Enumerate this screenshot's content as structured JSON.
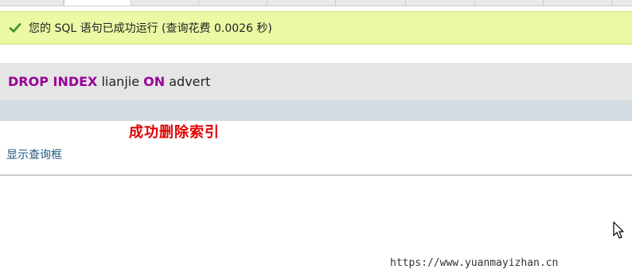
{
  "success": {
    "message": "您的 SQL 语句已成功运行 (查询花费 0.0026 秒)",
    "icon": "check-icon",
    "color": "#ebf8a4"
  },
  "sql": {
    "kw_drop": "DROP INDEX",
    "index_name": "lianjie",
    "kw_on": "ON",
    "table_name": "advert",
    "keyword_color": "#990099"
  },
  "annotation": {
    "text": "成功删除索引",
    "color": "#e00000"
  },
  "links": {
    "show_query_box": "显示查询框"
  },
  "watermark": {
    "text": "https://www.yuanmayizhan.cn"
  }
}
